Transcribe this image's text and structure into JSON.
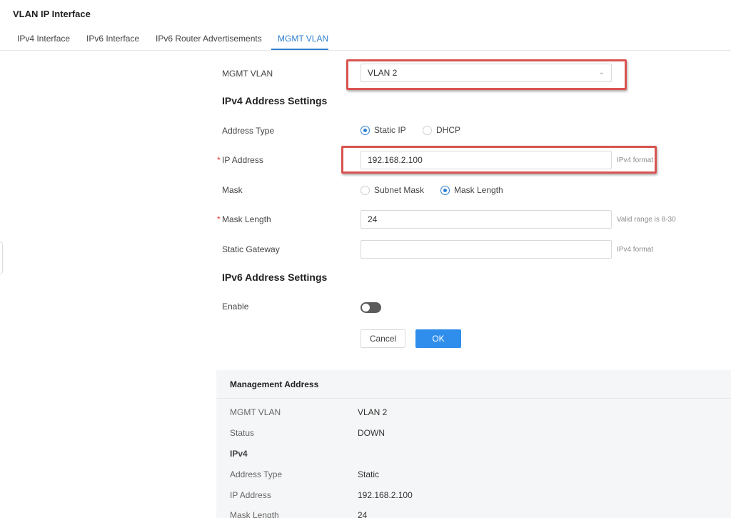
{
  "page": {
    "title": "VLAN IP Interface"
  },
  "tabs": [
    {
      "label": "IPv4 Interface"
    },
    {
      "label": "IPv6 Interface"
    },
    {
      "label": "IPv6 Router Advertisements"
    },
    {
      "label": "MGMT VLAN",
      "active": true
    }
  ],
  "form": {
    "mgmt_vlan": {
      "label": "MGMT VLAN",
      "value": "VLAN 2",
      "icon": "chevron-down-icon"
    },
    "ipv4_section": "IPv4 Address Settings",
    "address_type": {
      "label": "Address Type",
      "options": [
        "Static IP",
        "DHCP"
      ],
      "selected": "Static IP"
    },
    "ip_address": {
      "label": "IP Address",
      "required": "*",
      "value": "192.168.2.100",
      "hint": "IPv4 format"
    },
    "mask": {
      "label": "Mask",
      "options": [
        "Subnet Mask",
        "Mask Length"
      ],
      "selected": "Mask Length"
    },
    "mask_length": {
      "label": "Mask Length",
      "required": "*",
      "value": "24",
      "hint": "Valid range is 8-30"
    },
    "static_gateway": {
      "label": "Static Gateway",
      "value": "",
      "hint": "IPv4 format"
    },
    "ipv6_section": "IPv6 Address Settings",
    "enable": {
      "label": "Enable",
      "on": false
    },
    "cancel_label": "Cancel",
    "ok_label": "OK"
  },
  "management": {
    "title": "Management Address",
    "rows": [
      {
        "key": "MGMT VLAN",
        "value": "VLAN 2"
      },
      {
        "key": "Status",
        "value": "DOWN"
      }
    ],
    "ipv4_label": "IPv4",
    "ipv4_rows": [
      {
        "key": "Address Type",
        "value": "Static"
      },
      {
        "key": "IP Address",
        "value": "192.168.2.100"
      },
      {
        "key": "Mask Length",
        "value": "24"
      }
    ]
  },
  "colors": {
    "accent": "#2f80d1",
    "highlight": "#d9534f",
    "required": "#e4393c"
  }
}
